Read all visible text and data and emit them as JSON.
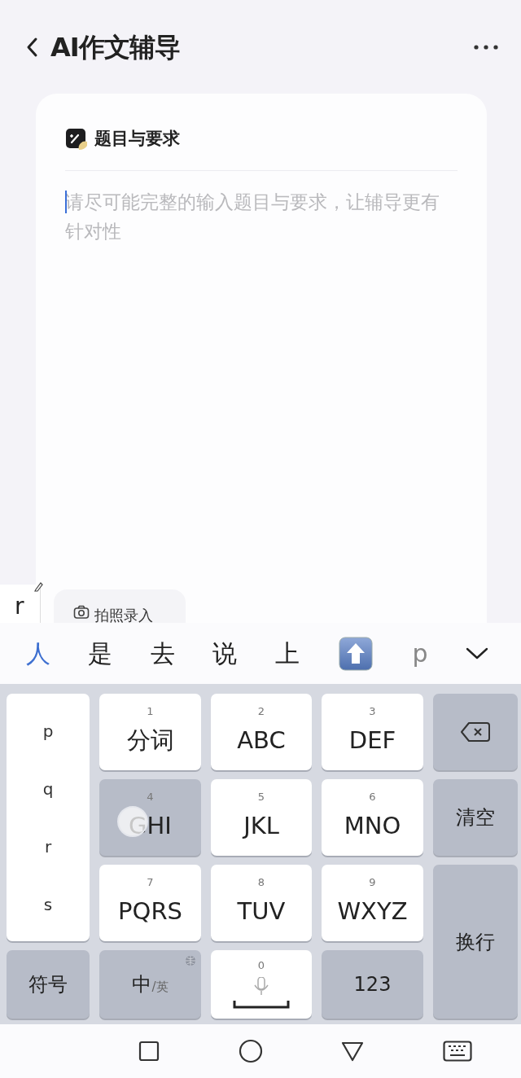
{
  "header": {
    "title": "AI作文辅导"
  },
  "card": {
    "heading": "题目与要求",
    "placeholder": "请尽可能完整的输入题目与要求，让辅导更有针对性",
    "photo_button": "拍照录入"
  },
  "composition": {
    "text": "r"
  },
  "candidates": [
    {
      "kind": "hanzi",
      "text": "人",
      "selected": true
    },
    {
      "kind": "hanzi",
      "text": "是",
      "selected": false
    },
    {
      "kind": "hanzi",
      "text": "去",
      "selected": false
    },
    {
      "kind": "hanzi",
      "text": "说",
      "selected": false
    },
    {
      "kind": "hanzi",
      "text": "上",
      "selected": false
    },
    {
      "kind": "emoji",
      "selected": false
    },
    {
      "kind": "latin",
      "text": "p",
      "selected": false
    }
  ],
  "pinyin_options": [
    "p",
    "q",
    "r",
    "s"
  ],
  "keys": [
    {
      "kind": "letter",
      "digit": "1",
      "label": "分词",
      "pressed": false
    },
    {
      "kind": "letter",
      "digit": "2",
      "label": "ABC",
      "pressed": false
    },
    {
      "kind": "letter",
      "digit": "3",
      "label": "DEF",
      "pressed": false
    },
    {
      "kind": "backspace",
      "pressed": false
    },
    {
      "kind": "letter",
      "digit": "4",
      "label": "GHI",
      "pressed": true
    },
    {
      "kind": "letter",
      "digit": "5",
      "label": "JKL",
      "pressed": false
    },
    {
      "kind": "letter",
      "digit": "6",
      "label": "MNO",
      "pressed": false
    },
    {
      "kind": "function",
      "label": "清空",
      "pressed": false
    },
    {
      "kind": "letter",
      "digit": "7",
      "label": "PQRS",
      "pressed": false
    },
    {
      "kind": "letter",
      "digit": "8",
      "label": "TUV",
      "pressed": false
    },
    {
      "kind": "letter",
      "digit": "9",
      "label": "WXYZ",
      "pressed": false
    },
    {
      "kind": "enter",
      "label": "换行",
      "pressed": false
    },
    {
      "kind": "function",
      "label": "符号",
      "pressed": false
    },
    {
      "kind": "language",
      "label": "中",
      "sublabel": "/英",
      "pressed": false
    },
    {
      "kind": "space",
      "digit": "0",
      "pressed": false
    },
    {
      "kind": "function",
      "label": "123",
      "pressed": false
    }
  ]
}
